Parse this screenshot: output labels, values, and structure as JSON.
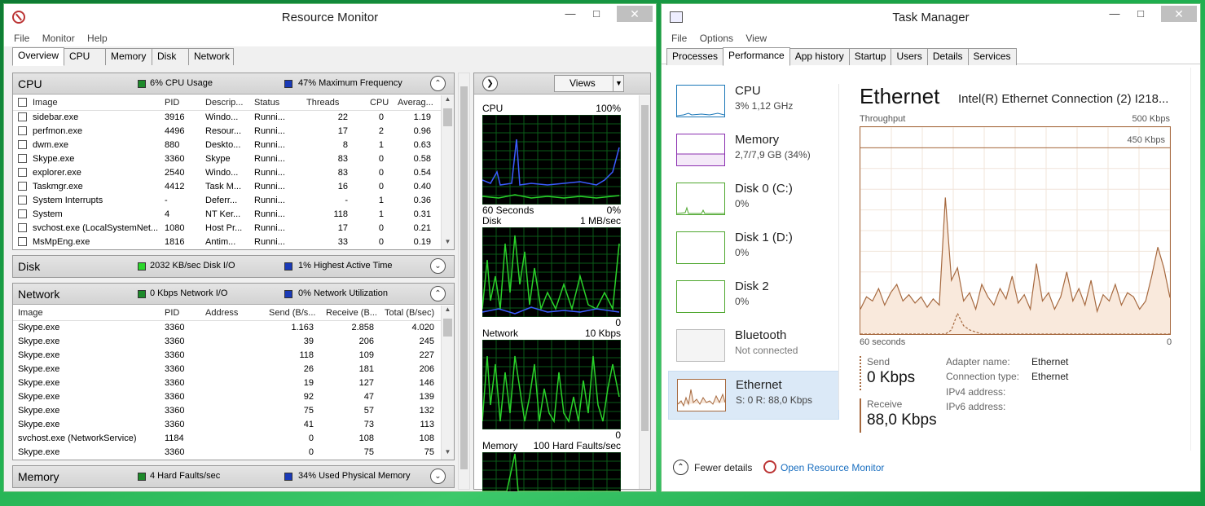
{
  "rm": {
    "title": "Resource Monitor",
    "menu": [
      "File",
      "Monitor",
      "Help"
    ],
    "tabs": [
      "Overview",
      "CPU",
      "Memory",
      "Disk",
      "Network"
    ],
    "cpu": {
      "name": "CPU",
      "stat1": "6% CPU Usage",
      "stat2": "47% Maximum Frequency",
      "columns": [
        "Image",
        "PID",
        "Descrip...",
        "Status",
        "Threads",
        "CPU",
        "Averag..."
      ],
      "rows": [
        [
          "sidebar.exe",
          "3916",
          "Windo...",
          "Runni...",
          "22",
          "0",
          "1.19"
        ],
        [
          "perfmon.exe",
          "4496",
          "Resour...",
          "Runni...",
          "17",
          "2",
          "0.96"
        ],
        [
          "dwm.exe",
          "880",
          "Deskto...",
          "Runni...",
          "8",
          "1",
          "0.63"
        ],
        [
          "Skype.exe",
          "3360",
          "Skype",
          "Runni...",
          "83",
          "0",
          "0.58"
        ],
        [
          "explorer.exe",
          "2540",
          "Windo...",
          "Runni...",
          "83",
          "0",
          "0.54"
        ],
        [
          "Taskmgr.exe",
          "4412",
          "Task M...",
          "Runni...",
          "16",
          "0",
          "0.40"
        ],
        [
          "System Interrupts",
          "-",
          "Deferr...",
          "Runni...",
          "-",
          "1",
          "0.36"
        ],
        [
          "System",
          "4",
          "NT Ker...",
          "Runni...",
          "118",
          "1",
          "0.31"
        ],
        [
          "svchost.exe (LocalSystemNet...",
          "1080",
          "Host Pr...",
          "Runni...",
          "17",
          "0",
          "0.21"
        ],
        [
          "MsMpEng.exe",
          "1816",
          "Antim...",
          "Runni...",
          "33",
          "0",
          "0.19"
        ]
      ]
    },
    "disk": {
      "name": "Disk",
      "stat1": "2032 KB/sec Disk I/O",
      "stat2": "1% Highest Active Time"
    },
    "network": {
      "name": "Network",
      "stat1": "0 Kbps Network I/O",
      "stat2": "0% Network Utilization",
      "columns": [
        "Image",
        "PID",
        "Address",
        "Send (B/s...",
        "Receive (B...",
        "Total (B/sec)"
      ],
      "rows": [
        [
          "Skype.exe",
          "3360",
          "",
          "1.163",
          "2.858",
          "4.020"
        ],
        [
          "Skype.exe",
          "3360",
          "",
          "39",
          "206",
          "245"
        ],
        [
          "Skype.exe",
          "3360",
          "",
          "118",
          "109",
          "227"
        ],
        [
          "Skype.exe",
          "3360",
          "",
          "26",
          "181",
          "206"
        ],
        [
          "Skype.exe",
          "3360",
          "",
          "19",
          "127",
          "146"
        ],
        [
          "Skype.exe",
          "3360",
          "",
          "92",
          "47",
          "139"
        ],
        [
          "Skype.exe",
          "3360",
          "",
          "75",
          "57",
          "132"
        ],
        [
          "Skype.exe",
          "3360",
          "",
          "41",
          "73",
          "113"
        ],
        [
          "svchost.exe (NetworkService)",
          "1184",
          "",
          "0",
          "108",
          "108"
        ],
        [
          "Skype.exe",
          "3360",
          "",
          "0",
          "75",
          "75"
        ]
      ]
    },
    "memory": {
      "name": "Memory",
      "stat1": "4 Hard Faults/sec",
      "stat2": "34% Used Physical Memory"
    },
    "views_label": "Views",
    "graphs": [
      {
        "name": "CPU",
        "max": "100%",
        "footer_left": "60 Seconds",
        "footer_right": "0%"
      },
      {
        "name": "Disk",
        "max": "1 MB/sec",
        "footer_left": "",
        "footer_right": "0"
      },
      {
        "name": "Network",
        "max": "10 Kbps",
        "footer_left": "",
        "footer_right": "0"
      },
      {
        "name": "Memory",
        "max": "100 Hard Faults/sec",
        "footer_left": "",
        "footer_right": ""
      }
    ]
  },
  "tm": {
    "title": "Task Manager",
    "menu": [
      "File",
      "Options",
      "View"
    ],
    "tabs": [
      "Processes",
      "Performance",
      "App history",
      "Startup",
      "Users",
      "Details",
      "Services"
    ],
    "items": [
      {
        "name": "CPU",
        "sub": "3% 1,12 GHz"
      },
      {
        "name": "Memory",
        "sub": "2,7/7,9 GB (34%)"
      },
      {
        "name": "Disk 0 (C:)",
        "sub": "0%"
      },
      {
        "name": "Disk 1 (D:)",
        "sub": "0%"
      },
      {
        "name": "Disk 2",
        "sub": "0%"
      },
      {
        "name": "Bluetooth",
        "sub": "Not connected"
      },
      {
        "name": "Ethernet",
        "sub": "S: 0 R: 88,0 Kbps"
      }
    ],
    "heading": "Ethernet",
    "adapter": "Intel(R) Ethernet Connection (2) I218...",
    "throughput_label": "Throughput",
    "scale_max": "500 Kbps",
    "scale_line": "450 Kbps",
    "x_left": "60 seconds",
    "x_right": "0",
    "send_label": "Send",
    "send_value": "0 Kbps",
    "receive_label": "Receive",
    "receive_value": "88,0 Kbps",
    "details": [
      {
        "k": "Adapter name:",
        "v": "Ethernet"
      },
      {
        "k": "Connection type:",
        "v": "Ethernet"
      },
      {
        "k": "IPv4 address:",
        "v": ""
      },
      {
        "k": "IPv6 address:",
        "v": ""
      }
    ],
    "fewer_details": "Fewer details",
    "open_rm": "Open Resource Monitor"
  },
  "chart_data": {
    "type": "area",
    "xlabel": "60 seconds",
    "ylim": [
      0,
      500
    ],
    "series": [
      {
        "name": "Receive",
        "values": [
          60,
          90,
          80,
          110,
          70,
          100,
          120,
          80,
          95,
          75,
          90,
          65,
          85,
          70,
          330,
          130,
          160,
          80,
          100,
          60,
          120,
          90,
          70,
          110,
          85,
          140,
          75,
          95,
          60,
          170,
          80,
          100,
          60,
          90,
          150,
          80,
          110,
          70,
          130,
          55,
          95,
          80,
          120,
          70,
          100,
          90,
          60,
          80,
          140,
          210,
          160,
          88
        ]
      },
      {
        "name": "Send",
        "values": [
          0,
          0,
          0,
          0,
          0,
          0,
          0,
          0,
          0,
          0,
          0,
          0,
          0,
          0,
          0,
          10,
          50,
          20,
          10,
          5,
          0,
          0,
          0,
          0,
          0,
          0,
          0,
          0,
          0,
          0,
          0,
          0,
          0,
          0,
          0,
          0,
          0,
          0,
          0,
          0,
          0,
          0,
          0,
          0,
          0,
          0,
          0,
          0,
          0,
          0,
          0,
          0
        ]
      }
    ]
  }
}
